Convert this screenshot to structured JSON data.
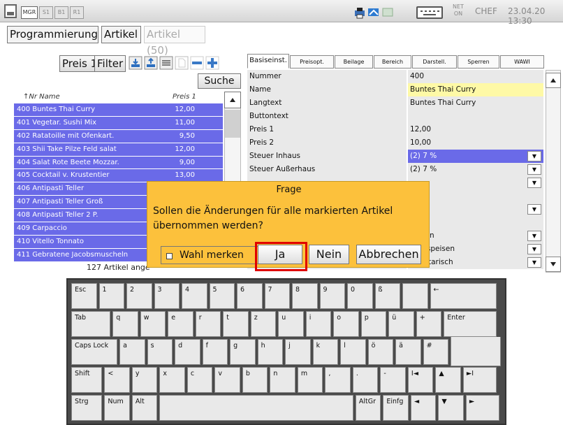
{
  "topbar": {
    "buttons": [
      "MGR",
      "S1",
      "B1",
      "R1"
    ],
    "net_label": "NET",
    "net_state": "ON",
    "user": "CHEF",
    "datetime": "23.04.20 13:30"
  },
  "breadcrumb": [
    "Programmierung",
    "Artikel",
    "Artikel (50)"
  ],
  "toolbar": {
    "price_level": "Preis 1",
    "filter": "Filter"
  },
  "search": {
    "label": "Suche"
  },
  "list": {
    "col_nr_name": "↑Nr Name",
    "col_price": "Preis 1",
    "rows": [
      {
        "name": "400 Buntes Thai Curry",
        "price": "12,00"
      },
      {
        "name": "401 Vegetar. Sushi Mix",
        "price": "11,00"
      },
      {
        "name": "402 Ratatoille mit Ofenkart.",
        "price": "9,50"
      },
      {
        "name": "403 Shii Take Pilze Feld salat",
        "price": "12,00"
      },
      {
        "name": "404 Salat Rote Beete Mozzar.",
        "price": "9,00"
      },
      {
        "name": "405 Cocktail v. Krustentier",
        "price": "13,00"
      },
      {
        "name": "406 Antipasti Teller",
        "price": ""
      },
      {
        "name": "407 Antipasti Teller Groß",
        "price": ""
      },
      {
        "name": "408 Antipasti Teller 2 P.",
        "price": ""
      },
      {
        "name": "409 Carpaccio",
        "price": ""
      },
      {
        "name": "410 Vitello Tonnato",
        "price": ""
      },
      {
        "name": "411 Gebratene Jacobsmuscheln",
        "price": ""
      }
    ],
    "count_text": "127 Artikel ange"
  },
  "tabs": [
    "Basiseinst.",
    "Preisopt.",
    "Beilage",
    "Bereich",
    "Darstell.",
    "Sperren",
    "WAWI"
  ],
  "properties": [
    {
      "label": "Nummer",
      "value": "400",
      "style": "",
      "dropdown": false
    },
    {
      "label": "Name",
      "value": "Buntes Thai Curry",
      "style": "yellow",
      "dropdown": false
    },
    {
      "label": "Langtext",
      "value": "Buntes Thai Curry",
      "style": "",
      "dropdown": false
    },
    {
      "label": "Buttontext",
      "value": "",
      "style": "",
      "dropdown": false
    },
    {
      "label": "Preis 1",
      "value": "12,00",
      "style": "",
      "dropdown": false
    },
    {
      "label": "Preis 2",
      "value": "10,00",
      "style": "",
      "dropdown": false
    },
    {
      "label": "Steuer Inhaus",
      "value": "(2) 7 %",
      "style": "blue",
      "dropdown": true
    },
    {
      "label": "Steuer Außerhaus",
      "value": "(2) 7 %",
      "style": "",
      "dropdown": true
    },
    {
      "label": "",
      "value": "",
      "style": "",
      "dropdown": true
    },
    {
      "label": "",
      "value": "",
      "style": "",
      "dropdown": false
    },
    {
      "label": "",
      "value": "üche",
      "style": "",
      "dropdown": true
    },
    {
      "label": "",
      "value": "",
      "style": "",
      "dropdown": false
    },
    {
      "label": "",
      "value": "peisen",
      "style": "",
      "dropdown": true
    },
    {
      "label": "",
      "value": "auptspeisen",
      "style": "",
      "dropdown": true
    },
    {
      "label": "",
      "value": "Vegetarisch",
      "style": "",
      "dropdown": true
    }
  ],
  "dialog": {
    "title": "Frage",
    "message": "Sollen die Änderungen für alle markierten Artikel übernommen werden?",
    "remember_label": "Wahl merken",
    "yes": "Ja",
    "no": "Nein",
    "cancel": "Abbrechen"
  },
  "keyboard": [
    [
      "Esc",
      "1",
      "2",
      "3",
      "4",
      "5",
      "6",
      "7",
      "8",
      "9",
      "0",
      "ß",
      "",
      "←"
    ],
    [
      "Tab",
      "q",
      "w",
      "e",
      "r",
      "t",
      "z",
      "u",
      "i",
      "o",
      "p",
      "ü",
      "+",
      "Enter"
    ],
    [
      "Caps Lock",
      "a",
      "s",
      "d",
      "f",
      "g",
      "h",
      "j",
      "k",
      "l",
      "ö",
      "ä",
      "#"
    ],
    [
      "Shift",
      "<",
      "y",
      "x",
      "c",
      "v",
      "b",
      "n",
      "m",
      ",",
      ".",
      "-",
      "I◄",
      "▲",
      "►I"
    ],
    [
      "Strg",
      "Num",
      "Alt",
      "",
      "AltGr",
      "Einfg",
      "◄",
      "▼",
      "►"
    ]
  ],
  "colors": {
    "selection": "#6a6ae8",
    "dialog": "#fcc13c",
    "highlight": "#e00000",
    "name_field": "#fef9a6"
  }
}
